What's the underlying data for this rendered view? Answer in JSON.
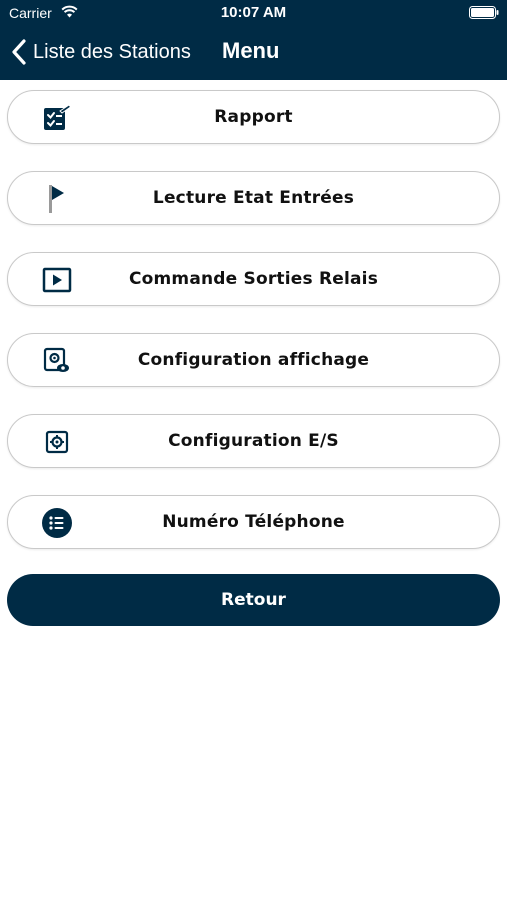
{
  "status_bar": {
    "carrier": "Carrier",
    "time": "10:07 AM"
  },
  "nav": {
    "back_label": "Liste des Stations",
    "title": "Menu"
  },
  "menu": {
    "items": [
      {
        "label": "Rapport",
        "icon": "checklist-icon"
      },
      {
        "label": "Lecture Etat Entrées",
        "icon": "flag-icon"
      },
      {
        "label": "Commande Sorties Relais",
        "icon": "play-icon"
      },
      {
        "label": "Configuration affichage",
        "icon": "display-settings-icon"
      },
      {
        "label": "Configuration E/S",
        "icon": "settings-icon"
      },
      {
        "label": "Numéro Téléphone",
        "icon": "list-icon"
      }
    ]
  },
  "retour_label": "Retour",
  "colors": {
    "primary": "#002b45",
    "background": "#ffffff",
    "border": "#c9c9c9"
  }
}
